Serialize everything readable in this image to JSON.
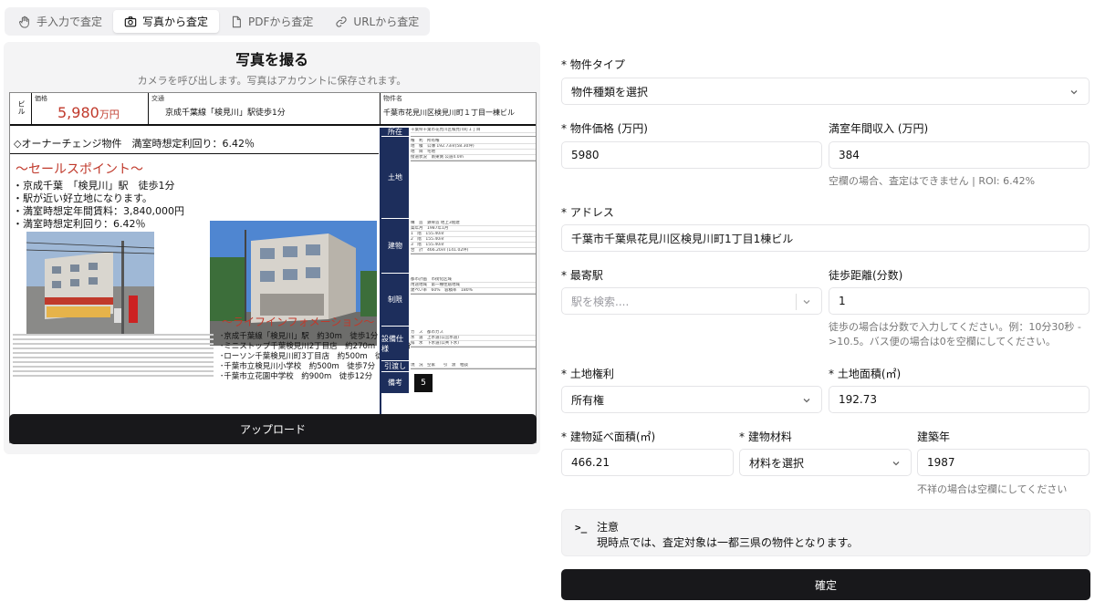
{
  "tabs": [
    {
      "label": "手入力で査定",
      "icon": "hand-icon"
    },
    {
      "label": "写真から査定",
      "icon": "camera-icon"
    },
    {
      "label": "PDFから査定",
      "icon": "file-icon"
    },
    {
      "label": "URLから査定",
      "icon": "link-icon"
    }
  ],
  "photo_card": {
    "title": "写真を撮る",
    "subtitle": "カメラを呼び出します。写真はアカウントに保存されます。",
    "upload_label": "アップロード"
  },
  "flyer": {
    "type_label": "ビル",
    "price_caption": "価格",
    "price_value": "5,980",
    "price_unit": "万円",
    "access_caption": "交通",
    "access_value": "京成千葉線「検見川」駅徒歩1分",
    "name_caption": "物件名",
    "name_value": "千葉市花見川区検見川町１丁目一棟ビル",
    "headline": "◇オーナーチェンジ物件　満室時想定利回り：6.42％",
    "sales_title": "～セールスポイント～",
    "sales_points": [
      "・京成千葉　「検見川」駅　徒歩1分",
      "・駅が近い好立地になります。",
      "・満室時想定年間賃料：3,840,000円",
      "・満室時想定利回り：6.42％"
    ],
    "info_title": "～ライフインフォメーション～",
    "info_lines": [
      "･京成千葉線「検見川」駅　約30m　徒歩1分",
      "･ミニストップ千葉検見川2丁目店　約270m　徒歩4分",
      "･ローソン千葉検見川町3丁目店　約500m　徒歩7分",
      "･千葉市立検見川小学校　約500m　徒歩7分",
      "･千葉市立花園中学校　約900m　徒歩12分"
    ],
    "side_sections": [
      "所在",
      "土地",
      "建物",
      "制限",
      "設備仕様",
      "引渡し",
      "備考"
    ],
    "side_address": "千葉県千葉市花見川区検見川町１丁目",
    "side_land": [
      "権　利　所有権",
      "地　積　公簿 192.73㎡(58.30坪)",
      "地　目　宅地",
      "接道状況　南東側 公道4.0m"
    ],
    "side_building": [
      "構　造　鉄骨造 地上3階建",
      "築年月　1987年1月",
      "1　階　155.40㎡",
      "2　階　155.40㎡",
      "3　階　155.40㎡",
      "合　計　466.20㎡ (141.02坪)"
    ],
    "side_limit": [
      "都市計画　市街化区域",
      "用途地域　第一種住居地域",
      "建ぺい率　60%　容積率　180%"
    ],
    "side_equip": [
      "ガ　ス　都市ガス",
      "水　道　上水道(公営水道)",
      "排　水　下水道(公共下水)"
    ],
    "side_handover": "現　況　空家　　引　渡　相談",
    "side_note_mark": "5"
  },
  "form": {
    "property_type": {
      "label": "* 物件タイプ",
      "placeholder": "物件種類を選択"
    },
    "price": {
      "label": "* 物件価格 (万円)",
      "value": "5980"
    },
    "income": {
      "label": "満室年間収入 (万円)",
      "value": "384",
      "helper": "空欄の場合、査定はできません | ROI: 6.42%"
    },
    "address": {
      "label": "* アドレス",
      "value": "千葉市千葉県花見川区検見川町1丁目1棟ビル"
    },
    "station": {
      "label": "* 最寄駅",
      "placeholder": "駅を検索...."
    },
    "walk": {
      "label": "徒歩距離(分数)",
      "value": "1",
      "helper_lines": [
        "徒歩の場合は分数で入力してください。例：10分30秒 -",
        ">10.5。バス便の場合は0を空欄にしてください。"
      ]
    },
    "land_right": {
      "label": "* 土地権利",
      "value": "所有権"
    },
    "land_area": {
      "label": "* 土地面積(㎡)",
      "value": "192.73"
    },
    "floor_area": {
      "label": "* 建物延べ面積(㎡)",
      "value": "466.21"
    },
    "material": {
      "label": "* 建物材料",
      "placeholder": "材料を選択"
    },
    "built_year": {
      "label": "建築年",
      "value": "1987",
      "helper": "不祥の場合は空欄にしてください"
    },
    "notice": {
      "title": "注意",
      "body": "現時点では、査定対象は一都三県の物件となります。"
    },
    "confirm_label": "確定"
  },
  "colors": {
    "accent_dark": "#18181b",
    "price_red": "#c0392b",
    "flyer_navy": "#1d2e5c"
  }
}
